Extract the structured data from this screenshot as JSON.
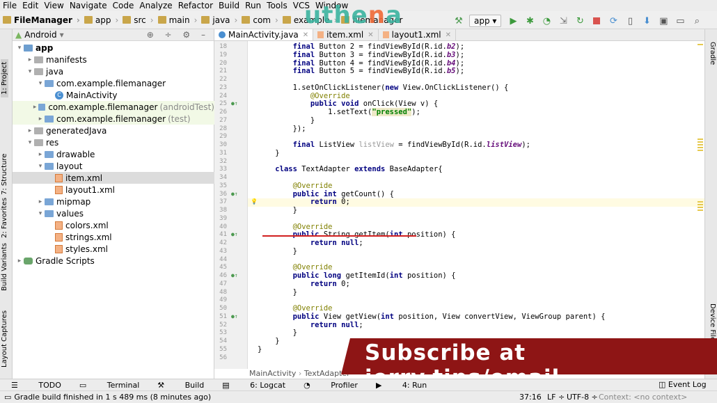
{
  "menu": [
    "File",
    "Edit",
    "View",
    "Navigate",
    "Code",
    "Analyze",
    "Refactor",
    "Build",
    "Run",
    "Tools",
    "VCS",
    "Window"
  ],
  "breadcrumb": [
    "FileManager",
    "app",
    "src",
    "main",
    "java",
    "com",
    "example",
    "filemanager"
  ],
  "watermark": {
    "text_a": "uthe",
    "text_b": "n",
    "text_c": "a"
  },
  "run_config": "app",
  "panel": {
    "title": "Android"
  },
  "tree": [
    {
      "label": "app",
      "suffix": "",
      "level": 0,
      "arrow": "▾",
      "icon": "module"
    },
    {
      "label": "manifests",
      "suffix": "",
      "level": 1,
      "arrow": "▸",
      "icon": "folder"
    },
    {
      "label": "java",
      "suffix": "",
      "level": 1,
      "arrow": "▾",
      "icon": "folder"
    },
    {
      "label": "com.example.filemanager",
      "suffix": "",
      "level": 2,
      "arrow": "▾",
      "icon": "folder"
    },
    {
      "label": "MainActivity",
      "suffix": "",
      "level": 3,
      "arrow": "",
      "icon": "class"
    },
    {
      "label": "com.example.filemanager",
      "suffix": "(androidTest)",
      "level": 2,
      "arrow": "▸",
      "icon": "folder"
    },
    {
      "label": "com.example.filemanager",
      "suffix": "(test)",
      "level": 2,
      "arrow": "▸",
      "icon": "folder"
    },
    {
      "label": "generatedJava",
      "suffix": "",
      "level": 1,
      "arrow": "▸",
      "icon": "folder"
    },
    {
      "label": "res",
      "suffix": "",
      "level": 1,
      "arrow": "▾",
      "icon": "folder"
    },
    {
      "label": "drawable",
      "suffix": "",
      "level": 2,
      "arrow": "▸",
      "icon": "folder"
    },
    {
      "label": "layout",
      "suffix": "",
      "level": 2,
      "arrow": "▾",
      "icon": "folder"
    },
    {
      "label": "item.xml",
      "suffix": "",
      "level": 3,
      "arrow": "",
      "icon": "xml"
    },
    {
      "label": "layout1.xml",
      "suffix": "",
      "level": 3,
      "arrow": "",
      "icon": "xml"
    },
    {
      "label": "mipmap",
      "suffix": "",
      "level": 2,
      "arrow": "▸",
      "icon": "folder"
    },
    {
      "label": "values",
      "suffix": "",
      "level": 2,
      "arrow": "▾",
      "icon": "folder"
    },
    {
      "label": "colors.xml",
      "suffix": "",
      "level": 3,
      "arrow": "",
      "icon": "xml"
    },
    {
      "label": "strings.xml",
      "suffix": "",
      "level": 3,
      "arrow": "",
      "icon": "xml"
    },
    {
      "label": "styles.xml",
      "suffix": "",
      "level": 3,
      "arrow": "",
      "icon": "xml"
    },
    {
      "label": "Gradle Scripts",
      "suffix": "",
      "level": 0,
      "arrow": "▸",
      "icon": "gradle"
    }
  ],
  "tabs": [
    {
      "label": "MainActivity.java",
      "type": "class"
    },
    {
      "label": "item.xml",
      "type": "xml"
    },
    {
      "label": "layout1.xml",
      "type": "xml"
    }
  ],
  "left_strip": [
    "1: Project",
    "7: Structure",
    "2: Favorites",
    "Build Variants",
    "Layout Captures"
  ],
  "right_strip": [
    "Gradle",
    "Device File"
  ],
  "code_lines": [
    {
      "n": "18",
      "t": "        final Button b2 = findViewById(R.id.b2);"
    },
    {
      "n": "19",
      "t": "        final Button b3 = findViewById(R.id.b3);"
    },
    {
      "n": "20",
      "t": "        final Button b4 = findViewById(R.id.b4);"
    },
    {
      "n": "21",
      "t": "        final Button b5 = findViewById(R.id.b5);"
    },
    {
      "n": "22",
      "t": ""
    },
    {
      "n": "23",
      "t": "        b1.setOnClickListener(new View.OnClickListener() {"
    },
    {
      "n": "24",
      "t": "            @Override"
    },
    {
      "n": "25",
      "t": "            public void onClick(View v) {"
    },
    {
      "n": "26",
      "t": "                b1.setText(\"pressed\");"
    },
    {
      "n": "27",
      "t": "            }"
    },
    {
      "n": "28",
      "t": "        });"
    },
    {
      "n": "29",
      "t": ""
    },
    {
      "n": "30",
      "t": "        final ListView listView = findViewById(R.id.listView);"
    },
    {
      "n": "31",
      "t": "    }"
    },
    {
      "n": "32",
      "t": ""
    },
    {
      "n": "33",
      "t": "    class TextAdapter extends BaseAdapter{"
    },
    {
      "n": "34",
      "t": ""
    },
    {
      "n": "35",
      "t": "        @Override"
    },
    {
      "n": "36",
      "t": "        public int getCount() {"
    },
    {
      "n": "37",
      "t": "            return 0;"
    },
    {
      "n": "38",
      "t": "        }"
    },
    {
      "n": "39",
      "t": ""
    },
    {
      "n": "40",
      "t": "        @Override"
    },
    {
      "n": "41",
      "t": "        public String getItem(int position) {"
    },
    {
      "n": "42",
      "t": "            return null;"
    },
    {
      "n": "43",
      "t": "        }"
    },
    {
      "n": "44",
      "t": ""
    },
    {
      "n": "45",
      "t": "        @Override"
    },
    {
      "n": "46",
      "t": "        public long getItemId(int position) {"
    },
    {
      "n": "47",
      "t": "            return 0;"
    },
    {
      "n": "48",
      "t": "        }"
    },
    {
      "n": "49",
      "t": ""
    },
    {
      "n": "50",
      "t": "        @Override"
    },
    {
      "n": "51",
      "t": "        public View getView(int position, View convertView, ViewGroup parent) {"
    },
    {
      "n": "52",
      "t": "            return null;"
    },
    {
      "n": "53",
      "t": "        }"
    },
    {
      "n": "54",
      "t": "    }"
    },
    {
      "n": "55",
      "t": "}"
    },
    {
      "n": "56",
      "t": ""
    }
  ],
  "editor_breadcrumb": [
    "MainActivity",
    "TextAdapter"
  ],
  "banner": "Subscribe at jerry.tips/email",
  "tool_windows": [
    "TODO",
    "Terminal",
    "Build",
    "6: Logcat",
    "Profiler",
    "4: Run"
  ],
  "event_log": "Event Log",
  "status": {
    "message": "Gradle build finished in 1 s 489 ms (8 minutes ago)",
    "position": "37:16",
    "line_sep": "LF ÷",
    "encoding": "UTF-8 ÷",
    "context": "Context: <no context>"
  }
}
